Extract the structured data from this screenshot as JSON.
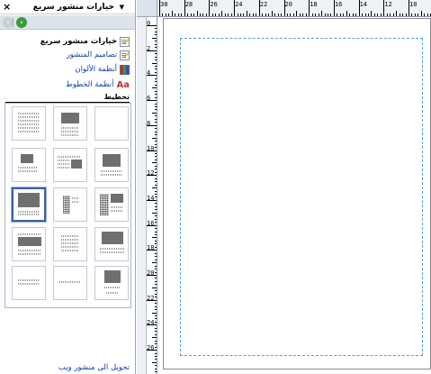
{
  "task_pane": {
    "title": "خيارات منشور سريع",
    "close_symbol": "×",
    "menu_symbol": "▼",
    "nav_back_icon": "green-arrow-icon",
    "nav_forward_icon": "gray-arrow-icon",
    "items": [
      {
        "label": "خيارات منشور سريع",
        "icon": "document-pen-icon",
        "style": "bold"
      },
      {
        "label": "تصاميم المنشور",
        "icon": "document-pen-icon",
        "style": "link"
      },
      {
        "label": "أنظمة الألوان",
        "icon": "color-grid-icon",
        "style": "link"
      },
      {
        "label": "أنظمة الخطوط",
        "icon": "font-icon",
        "style": "link",
        "glyph": "Aa"
      }
    ],
    "layout_section_label": "تخطيط",
    "selected_layout_index": 8,
    "layouts_count": 15,
    "bottom_link": "تحويل الى منشور ويب"
  },
  "rulers": {
    "top_labels": [
      "30",
      "28",
      "26",
      "24",
      "22",
      "20",
      "18",
      "16",
      "14",
      "12",
      "10"
    ],
    "left_labels": [
      "0",
      "2",
      "4",
      "6",
      "8",
      "10",
      "12",
      "14",
      "16",
      "18",
      "20",
      "22",
      "24",
      "26"
    ]
  },
  "colors": {
    "margin_guide": "#4aa0d8",
    "selection_border": "#3b5fa6",
    "link": "#0b3fa8",
    "nav_back": "#3a9a3a"
  }
}
